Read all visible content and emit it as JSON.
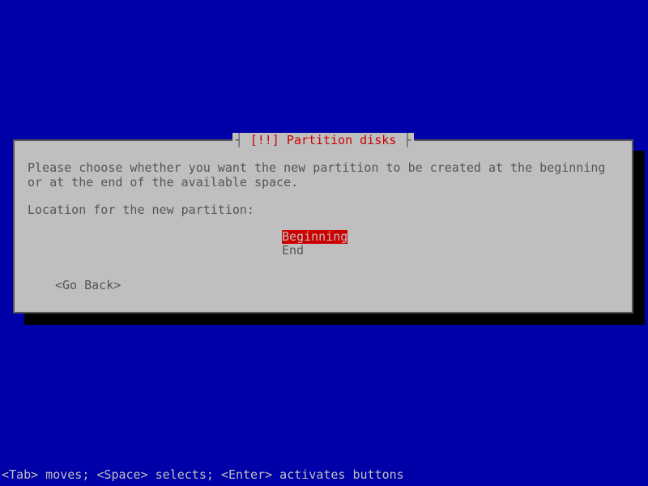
{
  "dialog": {
    "titleMark": "[!!]",
    "titleText": "Partition disks",
    "description": "Please choose whether you want the new partition to be created at the beginning or at the end of the available space.",
    "prompt": "Location for the new partition:",
    "options": {
      "selected": "Beginning",
      "other": "End"
    },
    "goBack": "<Go Back>"
  },
  "footer": "<Tab> moves; <Space> selects; <Enter> activates buttons"
}
